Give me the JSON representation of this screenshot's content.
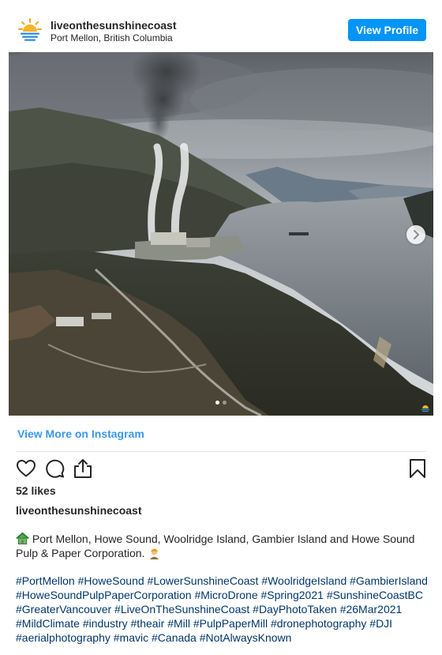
{
  "header": {
    "username": "liveonthesunshinecoast",
    "location": "Port Mellon, British Columbia",
    "view_profile_label": "View Profile"
  },
  "post": {
    "view_more_label": "View More on Instagram",
    "likes": "52 likes",
    "caption_user": "liveonthesunshinecoast",
    "caption_text": "Port Mellon, Howe Sound, Woolridge Island, Gambier Island and Howe Sound Pulp & Paper Corporation.",
    "hashtags": [
      "#PortMellon",
      "#HoweSound",
      "#LowerSunshineCoast",
      "#WoolridgeIsland",
      "#GambierIsland",
      "#HoweSoundPulpPaperCorporation",
      "#MicroDrone",
      "#Spring2021",
      "#SunshineCoastBC",
      "#GreaterVancouver",
      "#LiveOnTheSunshineCoast",
      "#DayPhotoTaken",
      "#26Mar2021",
      "#MildClimate",
      "#industry",
      "#theair",
      "#Mill",
      "#PulpPaperMill",
      "#dronephotography",
      "#DJI",
      "#aerialphotography",
      "#mavic",
      "#Canada",
      "#NotAlwaysKnown"
    ]
  },
  "carousel": {
    "current": 1,
    "total": 2
  },
  "icons": {
    "avatar": "sun-over-water-logo",
    "like": "heart-outline-icon",
    "comment": "speech-bubble-icon",
    "share": "share-upload-icon",
    "save": "bookmark-icon",
    "next": "chevron-right-icon"
  },
  "colors": {
    "accent": "#0095f6",
    "link": "#3897f0",
    "hashtag": "#00376b",
    "text": "#262626"
  }
}
